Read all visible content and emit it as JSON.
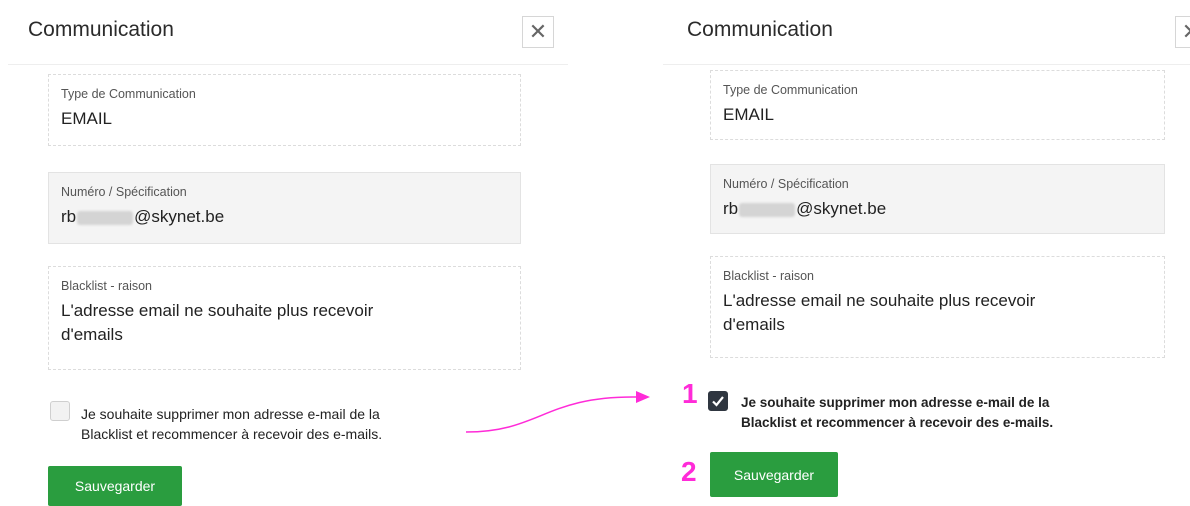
{
  "left": {
    "title": "Communication",
    "close_glyph": "✕",
    "type_label": "Type de Communication",
    "type_value": "EMAIL",
    "number_label": "Numéro / Spécification",
    "email_prefix": "rb",
    "email_suffix": "@skynet.be",
    "blacklist_label": "Blacklist - raison",
    "blacklist_line1": "L'adresse email ne souhaite plus recevoir",
    "blacklist_line2": "d'emails",
    "checkbox_checked": false,
    "checkbox_line1": "Je souhaite supprimer mon adresse e-mail de la",
    "checkbox_line2": "Blacklist et recommencer à recevoir des e-mails.",
    "save_label": "Sauvegarder"
  },
  "right": {
    "title": "Communication",
    "close_glyph": "✕",
    "type_label": "Type de Communication",
    "type_value": "EMAIL",
    "number_label": "Numéro / Spécification",
    "email_prefix": "rb",
    "email_suffix": "@skynet.be",
    "blacklist_label": "Blacklist - raison",
    "blacklist_line1": "L'adresse email ne souhaite plus recevoir",
    "blacklist_line2": "d'emails",
    "checkbox_checked": true,
    "checkbox_line1": "Je souhaite supprimer mon adresse e-mail de la",
    "checkbox_line2": "Blacklist et recommencer à recevoir des e-mails.",
    "save_label": "Sauvegarder"
  },
  "annotations": {
    "step1": "1",
    "step2": "2",
    "color": "#ff2bd8"
  },
  "colors": {
    "save_button": "#2a9d3f",
    "checkbox_checked": "#2f3640",
    "arrow": "#ff2bd8"
  },
  "icons": {
    "close": "close-icon",
    "check": "check-icon",
    "arrow": "arrow-icon"
  }
}
